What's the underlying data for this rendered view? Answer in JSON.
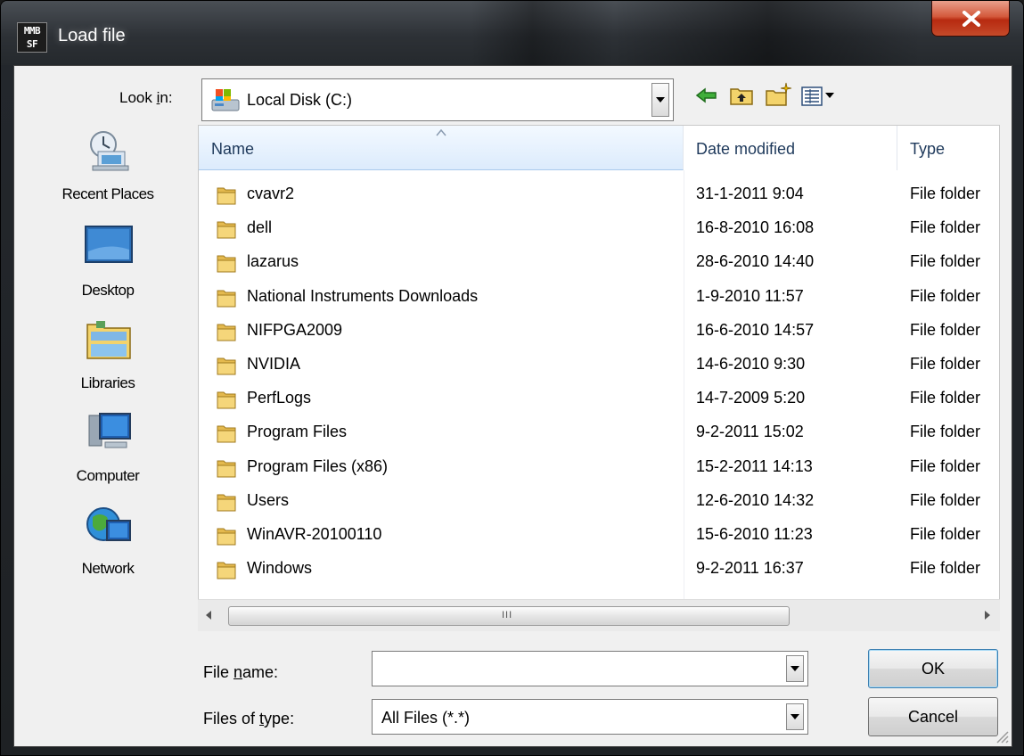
{
  "window": {
    "title": "Load file",
    "app_icon_text_top": "MMB",
    "app_icon_text_bottom": "SF",
    "close_icon": "close-icon"
  },
  "lookin": {
    "label_pre": "Look ",
    "label_accel": "i",
    "label_post": "n:",
    "value": "Local Disk (C:)",
    "drive_icon": "drive-icon"
  },
  "toolbar": {
    "buttons": [
      "back-icon",
      "up-folder-icon",
      "new-folder-icon",
      "view-menu-icon"
    ]
  },
  "places": [
    {
      "label": "Recent Places",
      "icon": "recent-places-icon"
    },
    {
      "label": "Desktop",
      "icon": "desktop-icon"
    },
    {
      "label": "Libraries",
      "icon": "libraries-icon"
    },
    {
      "label": "Computer",
      "icon": "computer-icon"
    },
    {
      "label": "Network",
      "icon": "network-icon"
    }
  ],
  "columns": {
    "name": "Name",
    "date": "Date modified",
    "type": "Type"
  },
  "files": [
    {
      "name": "cvavr2",
      "date": "31-1-2011 9:04",
      "type": "File folder"
    },
    {
      "name": "dell",
      "date": "16-8-2010 16:08",
      "type": "File folder"
    },
    {
      "name": "lazarus",
      "date": "28-6-2010 14:40",
      "type": "File folder"
    },
    {
      "name": "National Instruments Downloads",
      "date": "1-9-2010 11:57",
      "type": "File folder"
    },
    {
      "name": "NIFPGA2009",
      "date": "16-6-2010 14:57",
      "type": "File folder"
    },
    {
      "name": "NVIDIA",
      "date": "14-6-2010 9:30",
      "type": "File folder"
    },
    {
      "name": "PerfLogs",
      "date": "14-7-2009 5:20",
      "type": "File folder"
    },
    {
      "name": "Program Files",
      "date": "9-2-2011 15:02",
      "type": "File folder"
    },
    {
      "name": "Program Files (x86)",
      "date": "15-2-2011 14:13",
      "type": "File folder"
    },
    {
      "name": "Users",
      "date": "12-6-2010 14:32",
      "type": "File folder"
    },
    {
      "name": "WinAVR-20100110",
      "date": "15-6-2010 11:23",
      "type": "File folder"
    },
    {
      "name": "Windows",
      "date": "9-2-2011 16:37",
      "type": "File folder"
    }
  ],
  "scroll": {
    "grip": "III"
  },
  "filename": {
    "label_pre": "File ",
    "label_accel": "n",
    "label_post": "ame:",
    "value": ""
  },
  "filetype": {
    "label_pre": "Files of ",
    "label_accel": "t",
    "label_post": "ype:",
    "value": "All Files (*.*)"
  },
  "buttons": {
    "ok": "OK",
    "cancel": "Cancel"
  },
  "colors": {
    "close_button": "#c54a2a",
    "header_selected": "#dcebfc",
    "folder": "#e8c060"
  }
}
